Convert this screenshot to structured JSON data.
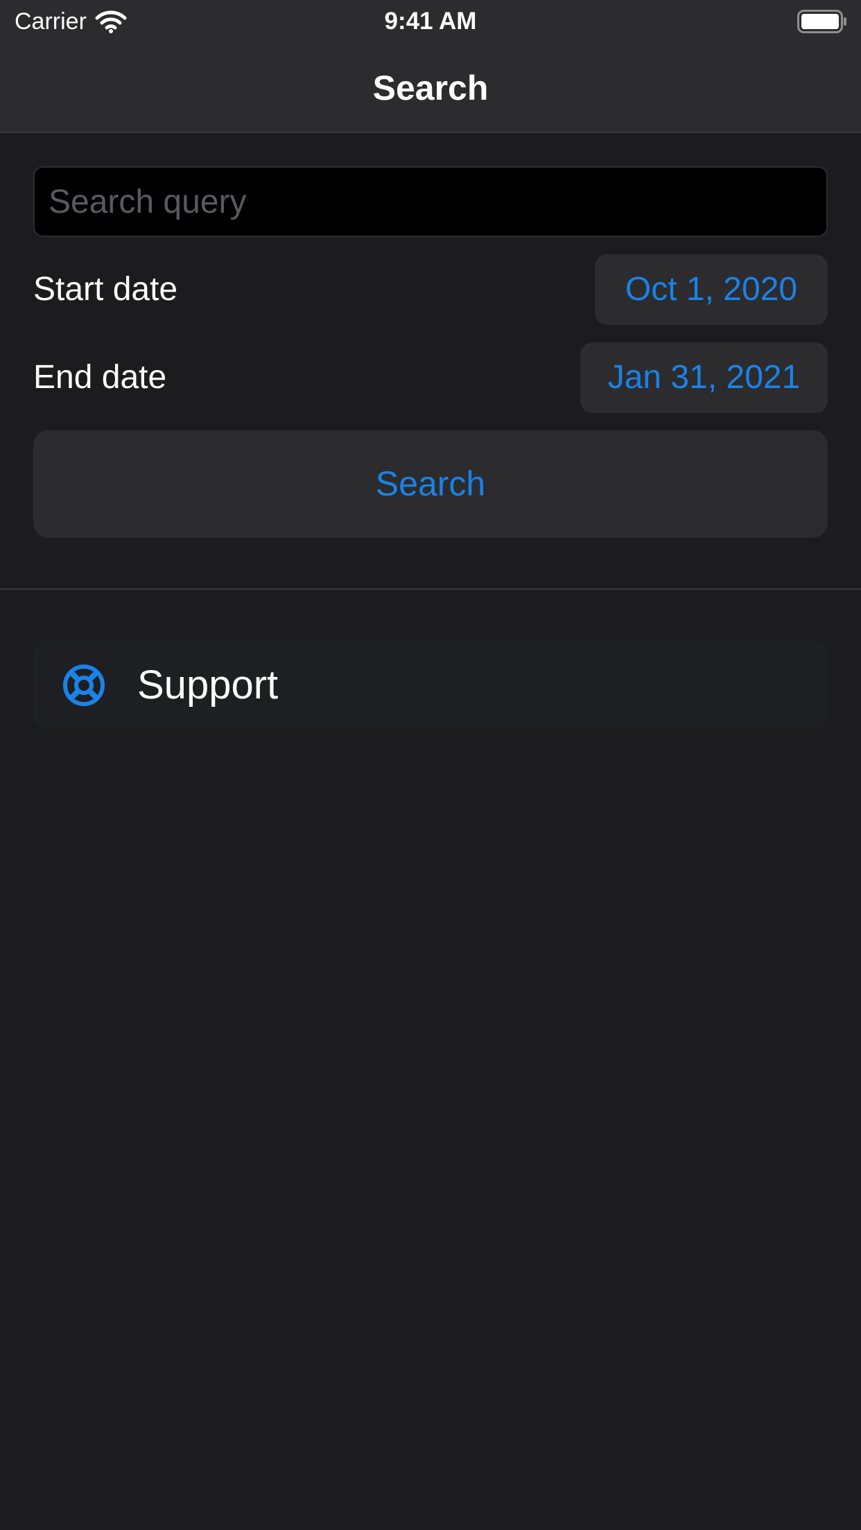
{
  "status_bar": {
    "carrier": "Carrier",
    "time": "9:41 AM",
    "wifi_icon": "wifi-icon",
    "battery_icon": "battery-full-icon"
  },
  "nav": {
    "title": "Search"
  },
  "form": {
    "query_placeholder": "Search query",
    "query_value": "",
    "start_label": "Start date",
    "start_value": "Oct 1, 2020",
    "end_label": "End date",
    "end_value": "Jan 31, 2021",
    "search_button": "Search"
  },
  "links": {
    "support_icon": "lifebuoy-icon",
    "support_label": "Support"
  },
  "colors": {
    "accent": "#1a82e8",
    "background": "#1c1c1e",
    "bar_background": "#2c2c2e"
  }
}
